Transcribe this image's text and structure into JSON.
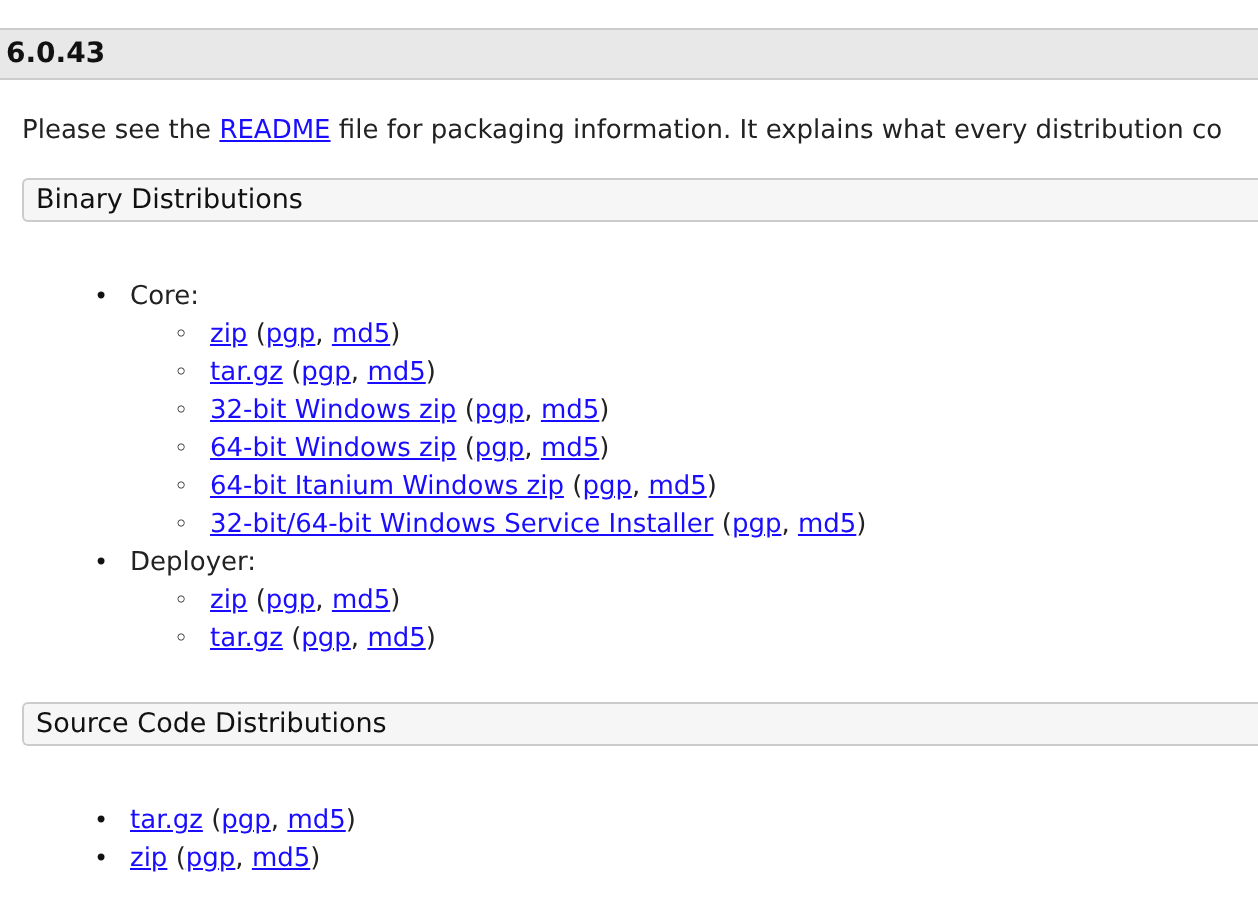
{
  "version_heading": "6.0.43",
  "intro": {
    "before": "Please see the ",
    "link": "README",
    "after": " file for packaging information. It explains what every distribution co"
  },
  "sections": [
    {
      "title": "Binary Distributions",
      "groups": [
        {
          "marker": "•",
          "label": "Core:",
          "items": [
            {
              "marker": "◦",
              "name": "zip",
              "open": "(",
              "signature": "pgp",
              "separator": ", ",
              "checksum": "md5",
              "close": ")"
            },
            {
              "marker": "◦",
              "name": "tar.gz",
              "open": "(",
              "signature": "pgp",
              "separator": ", ",
              "checksum": "md5",
              "close": ")"
            },
            {
              "marker": "◦",
              "name": "32-bit Windows zip",
              "open": "(",
              "signature": "pgp",
              "separator": ", ",
              "checksum": "md5",
              "close": ")"
            },
            {
              "marker": "◦",
              "name": "64-bit Windows zip",
              "open": "(",
              "signature": "pgp",
              "separator": ", ",
              "checksum": "md5",
              "close": ")"
            },
            {
              "marker": "◦",
              "name": "64-bit Itanium Windows zip",
              "open": "(",
              "signature": "pgp",
              "separator": ", ",
              "checksum": "md5",
              "close": ")"
            },
            {
              "marker": "◦",
              "name": "32-bit/64-bit Windows Service Installer",
              "open": "(",
              "signature": "pgp",
              "separator": ", ",
              "checksum": "md5",
              "close": ")"
            }
          ]
        },
        {
          "marker": "•",
          "label": "Deployer:",
          "items": [
            {
              "marker": "◦",
              "name": "zip",
              "open": "(",
              "signature": "pgp",
              "separator": ", ",
              "checksum": "md5",
              "close": ")"
            },
            {
              "marker": "◦",
              "name": "tar.gz",
              "open": "(",
              "signature": "pgp",
              "separator": ", ",
              "checksum": "md5",
              "close": ")"
            }
          ]
        }
      ]
    },
    {
      "title": "Source Code Distributions",
      "items": [
        {
          "marker": "•",
          "name": "tar.gz",
          "open": "(",
          "signature": "pgp",
          "separator": ", ",
          "checksum": "md5",
          "close": ")"
        },
        {
          "marker": "•",
          "name": "zip",
          "open": "(",
          "signature": "pgp",
          "separator": ", ",
          "checksum": "md5",
          "close": ")"
        }
      ]
    }
  ]
}
